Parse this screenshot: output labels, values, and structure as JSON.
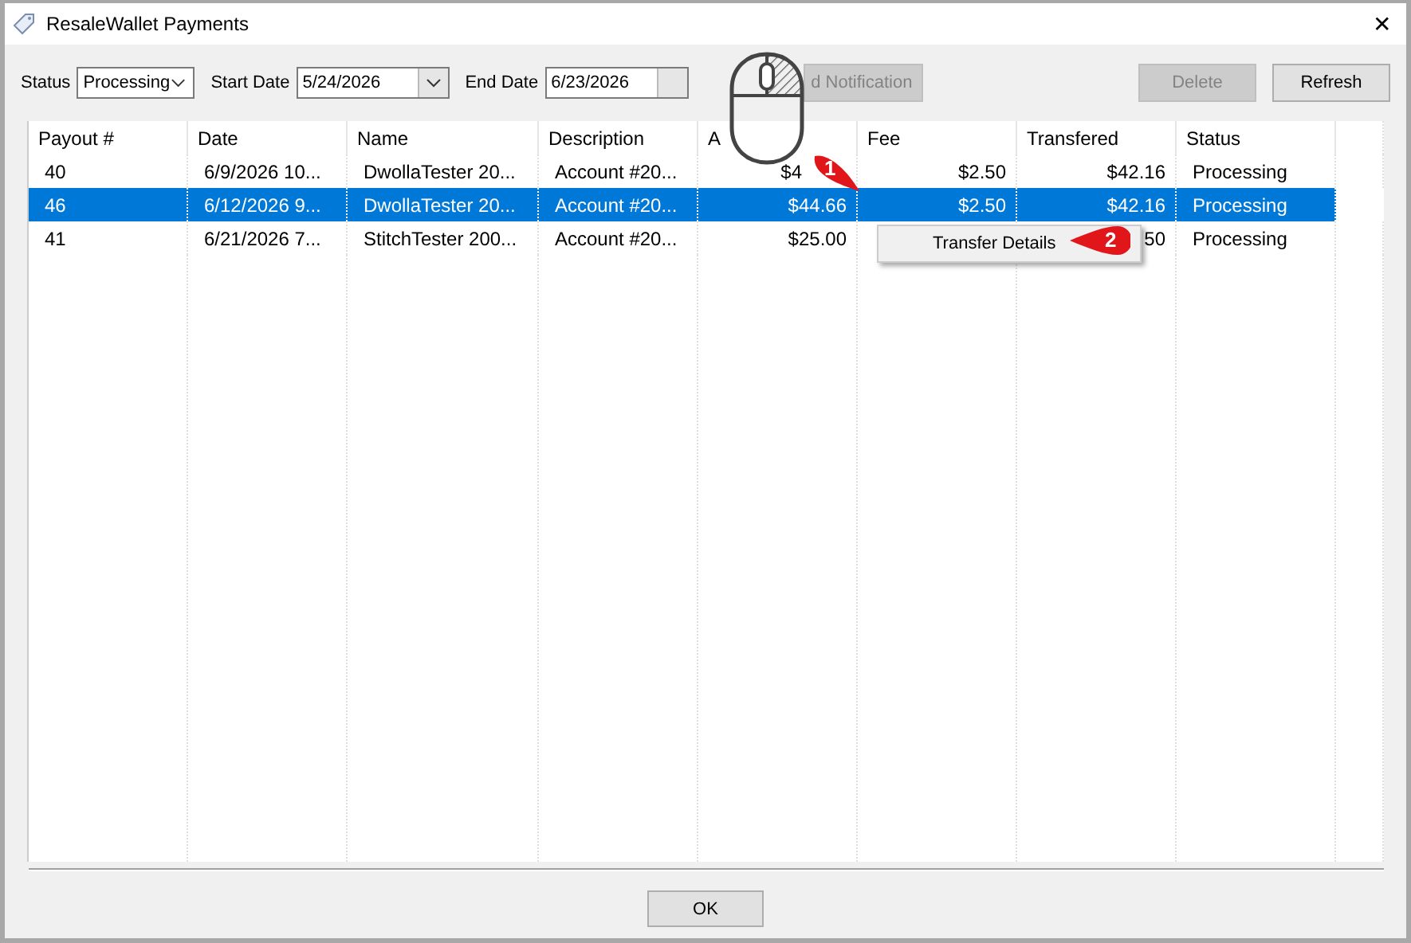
{
  "window": {
    "title": "ResaleWallet Payments",
    "close": "✕"
  },
  "filters": {
    "status_label": "Status",
    "status_value": "Processing",
    "start_label": "Start Date",
    "start_value": "5/24/2026",
    "end_label": "End Date",
    "end_value": "6/23/2026"
  },
  "toolbar_buttons": [
    {
      "label": "d Notification",
      "disabled": true
    },
    {
      "label": "Delete",
      "disabled": true
    },
    {
      "label": "Refresh",
      "disabled": false
    }
  ],
  "table": {
    "columns": [
      "Payout #",
      "Date",
      "Name",
      "Description",
      "A",
      "Fee",
      "Transfered",
      "Status"
    ],
    "rows": [
      {
        "selected": false,
        "cells": [
          "40",
          "6/9/2026 10...",
          "DwollaTester 20...",
          "Account #20...",
          "$4",
          "$2.50",
          "$42.16",
          "Processing"
        ]
      },
      {
        "selected": true,
        "cells": [
          "46",
          "6/12/2026 9...",
          "DwollaTester 20...",
          "Account #20...",
          "$44.66",
          "$2.50",
          "$42.16",
          "Processing"
        ]
      },
      {
        "selected": false,
        "cells": [
          "41",
          "6/21/2026 7...",
          "StitchTester 200...",
          "Account #20...",
          "$25.00",
          "",
          "50",
          "Processing"
        ]
      }
    ]
  },
  "context_menu": {
    "items": [
      "Transfer Details"
    ]
  },
  "callouts": [
    "1",
    "2"
  ],
  "footer": {
    "ok": "OK"
  }
}
